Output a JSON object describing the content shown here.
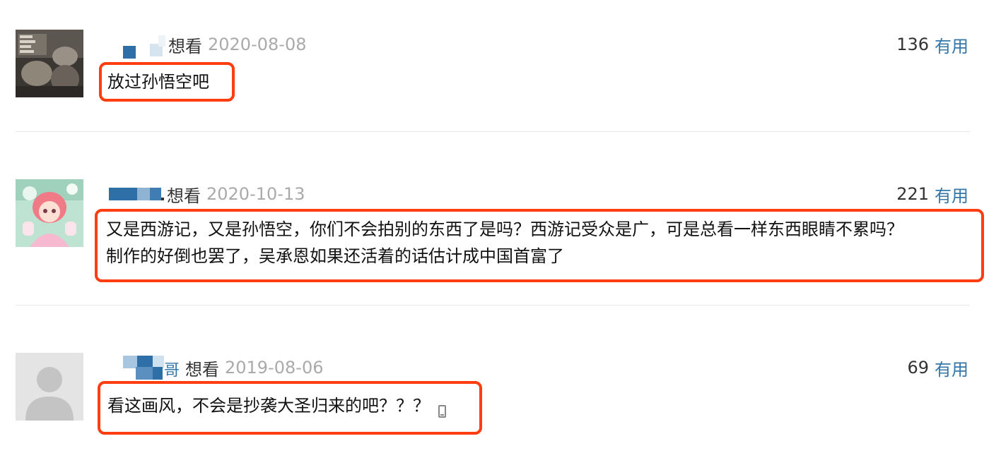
{
  "comments": [
    {
      "status": "想看",
      "date": "2020-08-08",
      "votes": "136",
      "useful_label": "有用",
      "content": "放过孙悟空吧"
    },
    {
      "status": "想看",
      "date": "2020-10-13",
      "votes": "221",
      "useful_label": "有用",
      "content_line1": "又是西游记，又是孙悟空，你们不会拍别的东西了是吗？西游记受众是广，可是总看一样东西眼睛不累吗？",
      "content_line2": "制作的好倒也罢了，吴承恩如果还活着的话估计成中国首富了"
    },
    {
      "status": "想看",
      "date": "2019-08-06",
      "votes": "69",
      "useful_label": "有用",
      "content": "看这画风，不会是抄袭大圣归来的吧？？？",
      "username_fragment": "哥"
    }
  ],
  "colors": {
    "highlight_border": "#ff3d0f",
    "link": "#3377aa",
    "date": "#aaaaaa"
  },
  "icons": {
    "mobile": "mobile-phone-icon",
    "default_avatar": "default-user-avatar"
  }
}
